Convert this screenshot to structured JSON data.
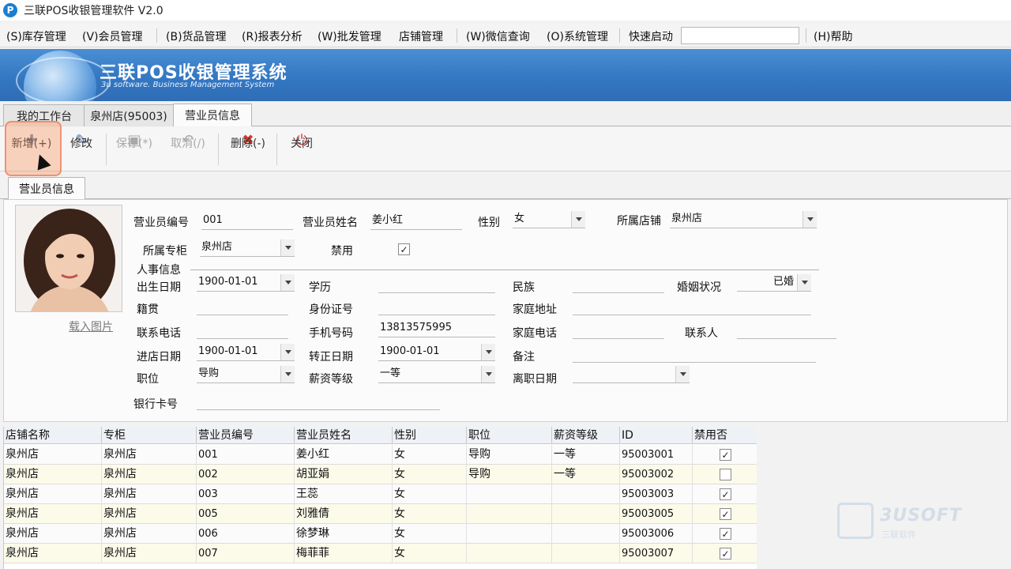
{
  "window": {
    "title": "三联POS收银管理软件 V2.0",
    "logo_letter": "P"
  },
  "menu": {
    "items": [
      "(S)库存管理",
      "(V)会员管理",
      "(B)货品管理",
      "(R)报表分析",
      "(W)批发管理",
      "店铺管理",
      "(W)微信查询",
      "(O)系统管理",
      "快速启动",
      "(H)帮助"
    ],
    "quick_launch_value": ""
  },
  "banner": {
    "title": "三联POS收银管理系统",
    "subtitle": "3u software. Business Management System"
  },
  "tabs": [
    "我的工作台",
    "泉州店(95003)",
    "营业员信息"
  ],
  "toolbar": [
    {
      "label": "新增(+)",
      "icon": "plus-icon",
      "enabled": true
    },
    {
      "label": "修改",
      "icon": "edit-icon",
      "enabled": true
    },
    {
      "label": "保存(*)",
      "icon": "save-icon",
      "enabled": false
    },
    {
      "label": "取消(/)",
      "icon": "undo-icon",
      "enabled": false
    },
    {
      "label": "删除(-)",
      "icon": "delete-icon",
      "enabled": true
    },
    {
      "label": "关闭",
      "icon": "power-icon",
      "enabled": true
    }
  ],
  "subtab": "营业员信息",
  "form": {
    "upload_photo": "载入图片",
    "labels": {
      "emp_no": "营业员编号",
      "emp_name": "营业员姓名",
      "gender": "性别",
      "store": "所属店铺",
      "counter": "所属专柜",
      "disabled": "禁用",
      "hr_section": "人事信息",
      "birth": "出生日期",
      "education": "学历",
      "ethnic": "民族",
      "marital": "婚姻状况",
      "native": "籍贯",
      "id_card": "身份证号",
      "home_addr": "家庭地址",
      "phone": "联系电话",
      "mobile": "手机号码",
      "home_phone": "家庭电话",
      "contact": "联系人",
      "join_date": "进店日期",
      "regular_date": "转正日期",
      "remark": "备注",
      "position": "职位",
      "salary_level": "薪资等级",
      "leave_date": "离职日期",
      "bank_card": "银行卡号"
    },
    "values": {
      "emp_no": "001",
      "emp_name": "姜小红",
      "gender": "女",
      "store": "泉州店",
      "counter": "泉州店",
      "disabled": true,
      "birth": "1900-01-01",
      "education": "",
      "ethnic": "",
      "marital": "已婚",
      "native": "",
      "id_card": "",
      "home_addr": "",
      "phone": "",
      "mobile": "13813575995",
      "home_phone": "",
      "contact": "",
      "join_date": "1900-01-01",
      "regular_date": "1900-01-01",
      "remark": "",
      "position": "导购",
      "salary_level": "一等",
      "leave_date": "",
      "bank_card": ""
    }
  },
  "grid": {
    "columns": [
      "店铺名称",
      "专柜",
      "营业员编号",
      "营业员姓名",
      "性别",
      "职位",
      "薪资等级",
      "ID",
      "禁用否"
    ],
    "rows": [
      {
        "store": "泉州店",
        "counter": "泉州店",
        "no": "001",
        "name": "姜小红",
        "gender": "女",
        "position": "导购",
        "salary": "一等",
        "id": "95003001",
        "disabled": true
      },
      {
        "store": "泉州店",
        "counter": "泉州店",
        "no": "002",
        "name": "胡亚娟",
        "gender": "女",
        "position": "导购",
        "salary": "一等",
        "id": "95003002",
        "disabled": false
      },
      {
        "store": "泉州店",
        "counter": "泉州店",
        "no": "003",
        "name": "王蕊",
        "gender": "女",
        "position": "",
        "salary": "",
        "id": "95003003",
        "disabled": true
      },
      {
        "store": "泉州店",
        "counter": "泉州店",
        "no": "005",
        "name": "刘雅倩",
        "gender": "女",
        "position": "",
        "salary": "",
        "id": "95003005",
        "disabled": true
      },
      {
        "store": "泉州店",
        "counter": "泉州店",
        "no": "006",
        "name": "徐梦琳",
        "gender": "女",
        "position": "",
        "salary": "",
        "id": "95003006",
        "disabled": true
      },
      {
        "store": "泉州店",
        "counter": "泉州店",
        "no": "007",
        "name": "梅菲菲",
        "gender": "女",
        "position": "",
        "salary": "",
        "id": "95003007",
        "disabled": true
      }
    ]
  },
  "watermark": {
    "brand": "3USOFT",
    "sub": "三联软件"
  }
}
